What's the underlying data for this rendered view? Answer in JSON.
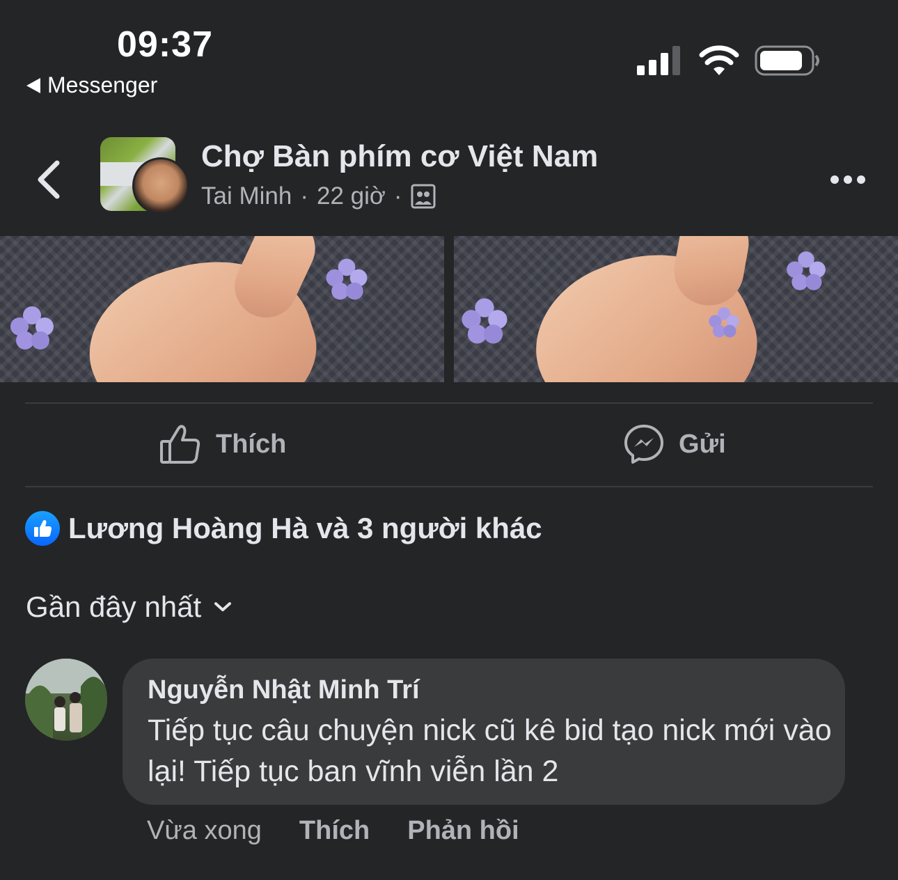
{
  "status_bar": {
    "time": "09:37",
    "back_app": "Messenger"
  },
  "post": {
    "group_name": "Chợ Bàn phím cơ Việt Nam",
    "author": "Tai Minh",
    "separator": "·",
    "time": "22 giờ",
    "audience_icon": "group-audience-icon"
  },
  "actions": {
    "like": "Thích",
    "send": "Gửi"
  },
  "reactions": {
    "summary": "Lương Hoàng Hà và 3 người khác"
  },
  "comments": {
    "sort_label": "Gần đây nhất",
    "items": [
      {
        "author": "Nguyễn Nhật Minh Trí",
        "text": "Tiếp tục câu chuyện nick cũ kê bid tạo nick mới vào lại! Tiếp tục ban vĩnh viễn lần 2",
        "time": "Vừa xong",
        "like": "Thích",
        "reply": "Phản hồi"
      }
    ]
  },
  "colors": {
    "background": "#242527",
    "bubble": "#3a3b3c",
    "secondary_text": "#b0b3b8",
    "like_blue": "#0866ff"
  }
}
